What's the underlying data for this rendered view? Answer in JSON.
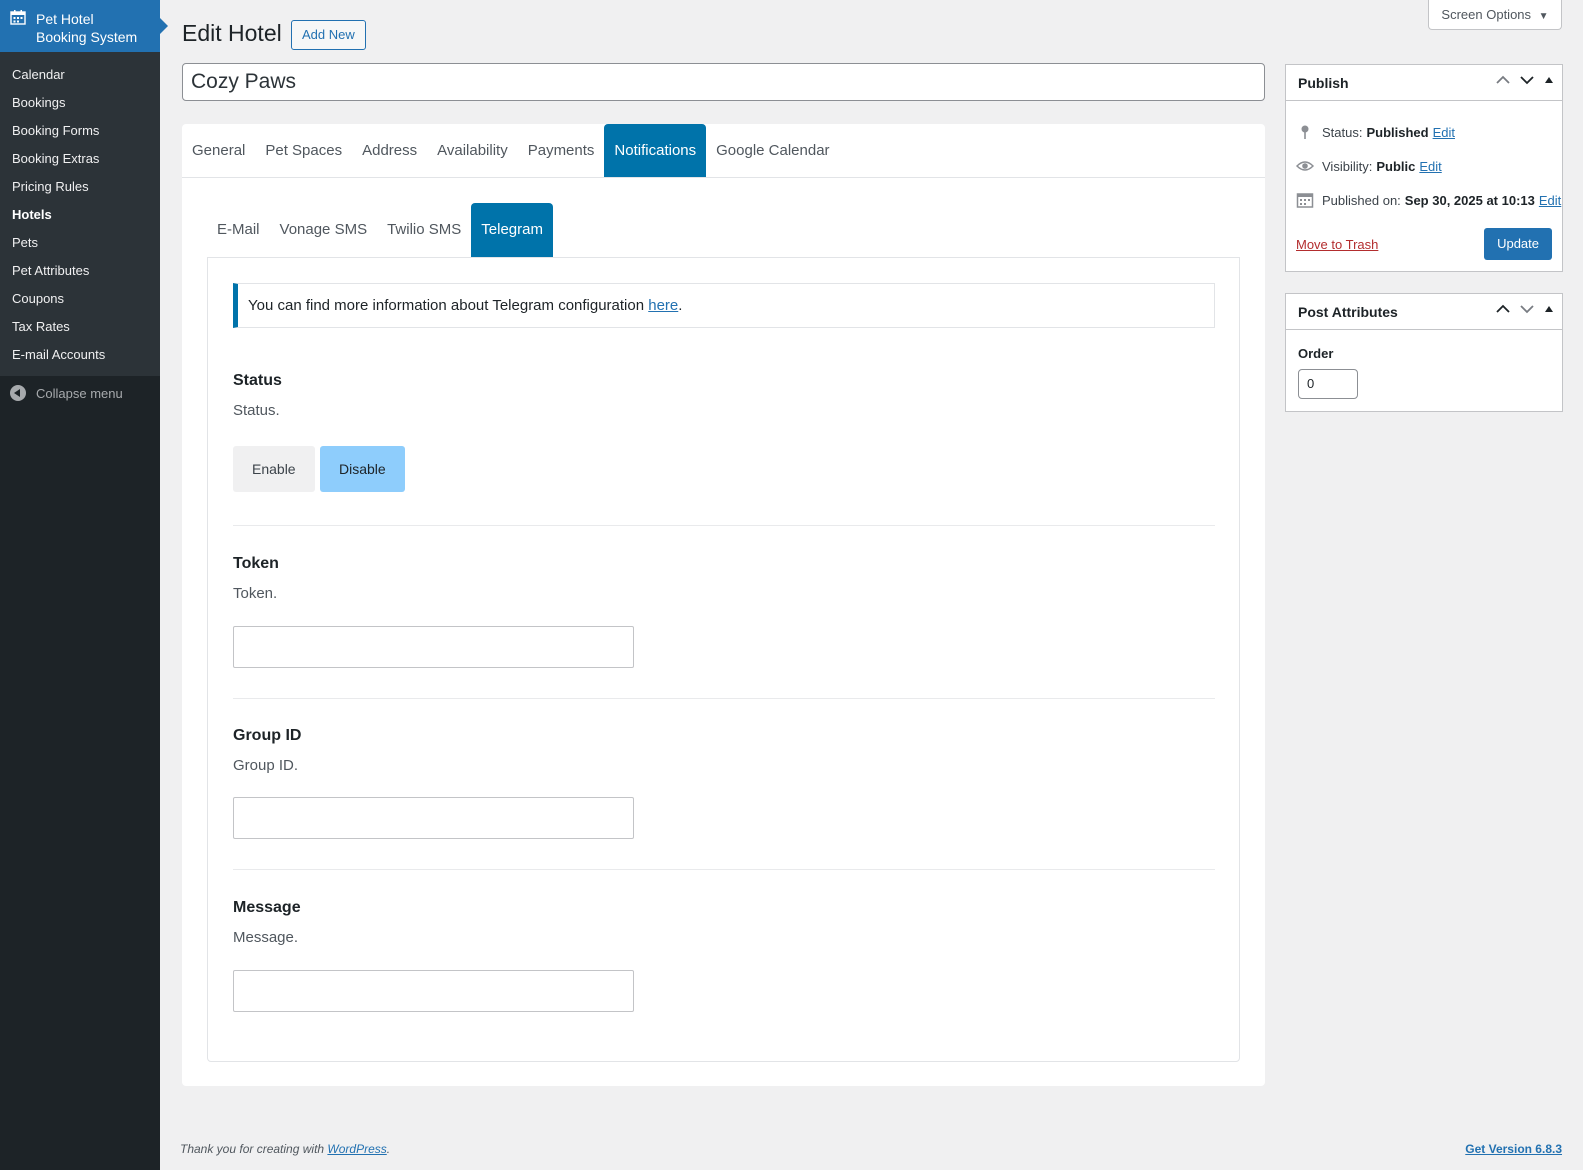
{
  "sidebar": {
    "brand_line1": "Pet Hotel",
    "brand_line2": "Booking System",
    "items": [
      {
        "label": "Calendar"
      },
      {
        "label": "Bookings"
      },
      {
        "label": "Booking Forms"
      },
      {
        "label": "Booking Extras"
      },
      {
        "label": "Pricing Rules"
      },
      {
        "label": "Hotels"
      },
      {
        "label": "Pets"
      },
      {
        "label": "Pet Attributes"
      },
      {
        "label": "Coupons"
      },
      {
        "label": "Tax Rates"
      },
      {
        "label": "E-mail Accounts"
      }
    ],
    "current_item": "Hotels",
    "collapse_label": "Collapse menu"
  },
  "header": {
    "screen_options": "Screen Options",
    "title": "Edit Hotel",
    "add_new": "Add New"
  },
  "post_title": "Cozy Paws",
  "tabs": [
    {
      "label": "General"
    },
    {
      "label": "Pet Spaces"
    },
    {
      "label": "Address"
    },
    {
      "label": "Availability"
    },
    {
      "label": "Payments"
    },
    {
      "label": "Notifications"
    },
    {
      "label": "Google Calendar"
    }
  ],
  "active_tab": "Notifications",
  "subtabs": [
    {
      "label": "E-Mail"
    },
    {
      "label": "Vonage SMS"
    },
    {
      "label": "Twilio SMS"
    },
    {
      "label": "Telegram"
    }
  ],
  "active_subtab": "Telegram",
  "notice": {
    "text": "You can find more information about Telegram configuration ",
    "link": "here",
    "suffix": "."
  },
  "fields": {
    "status": {
      "label": "Status",
      "desc": "Status.",
      "enable": "Enable",
      "disable": "Disable",
      "selected": "Disable"
    },
    "token": {
      "label": "Token",
      "desc": "Token.",
      "value": ""
    },
    "group_id": {
      "label": "Group ID",
      "desc": "Group ID.",
      "value": ""
    },
    "message": {
      "label": "Message",
      "desc": "Message.",
      "value": ""
    }
  },
  "publish": {
    "title": "Publish",
    "status_label": "Status:",
    "status_value": "Published",
    "visibility_label": "Visibility:",
    "visibility_value": "Public",
    "published_label": "Published on:",
    "published_value": "Sep 30, 2025 at 10:13",
    "edit": "Edit",
    "trash": "Move to Trash",
    "update": "Update"
  },
  "attributes": {
    "title": "Post Attributes",
    "order_label": "Order",
    "order_value": "0"
  },
  "footer": {
    "thanks": "Thank you for creating with ",
    "wp": "WordPress",
    "period": ".",
    "version": "Get Version 6.8.3"
  },
  "colors": {
    "sidebar_bg": "#1d2327",
    "brand_bg": "#2271b1",
    "tab_active": "#0073aa",
    "disable_active": "#8ecdfc",
    "trash": "#b32d2e"
  }
}
